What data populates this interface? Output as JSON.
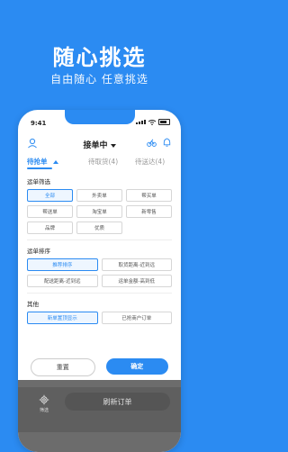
{
  "hero": {
    "title": "随心挑选",
    "subtitle": "自由随心 任意挑选"
  },
  "status_bar": {
    "time": "9:41"
  },
  "header": {
    "title": "接单中"
  },
  "tabs": [
    {
      "label": "待抢单"
    },
    {
      "label": "待取货(4)"
    },
    {
      "label": "待送达(4)"
    }
  ],
  "filters": {
    "waybill": {
      "label": "运单筛选",
      "options": [
        "全部",
        "外卖单",
        "帮买单",
        "帮送单",
        "淘宝单",
        "新零售",
        "品牌",
        "优质"
      ]
    },
    "sort": {
      "label": "运单排序",
      "options": [
        "推荐排序",
        "取货距离-近到远",
        "配送距离-近到远",
        "运单金额-高到低"
      ]
    },
    "other": {
      "label": "其他",
      "options": [
        "新单置顶显示",
        "已抢商户订单"
      ]
    }
  },
  "actions": {
    "reset": "重置",
    "confirm": "确定"
  },
  "bottom": {
    "filter_label": "筛选",
    "refresh_label": "刷新订单"
  },
  "colors": {
    "brand_blue": "#2b8bf2"
  }
}
